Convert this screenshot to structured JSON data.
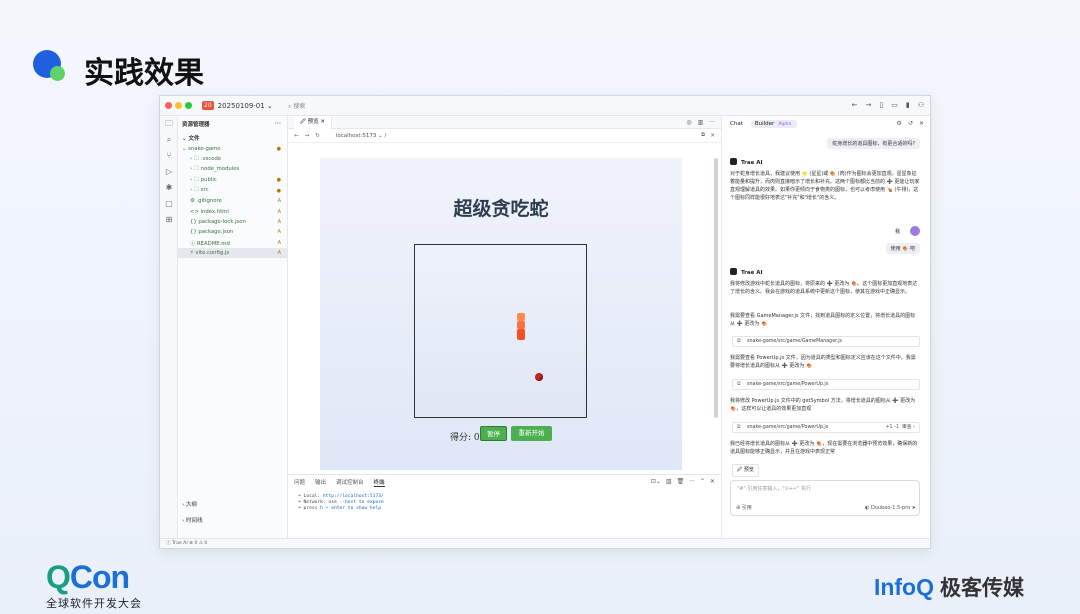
{
  "slide": {
    "title": "实践效果"
  },
  "titlebar": {
    "badge": "20",
    "project": "20250109-01 ⌄",
    "search": "⌕ 搜索"
  },
  "explorer": {
    "title": "资源管理器",
    "more": "···",
    "section": "⌄ 文件",
    "items": [
      {
        "label": "⌄ snake-game",
        "mark": "●"
      },
      {
        "label": "› 🗀 .vscode",
        "mark": ""
      },
      {
        "label": "› 🗀 node_modules",
        "mark": ""
      },
      {
        "label": "› 🗀 public",
        "mark": "●"
      },
      {
        "label": "› 🗀 src",
        "mark": "●"
      },
      {
        "label": "⚙ .gitignore",
        "mark": "A"
      },
      {
        "label": "<> index.html",
        "mark": "A"
      },
      {
        "label": "{} package-lock.json",
        "mark": "A"
      },
      {
        "label": "{} package.json",
        "mark": "A"
      },
      {
        "label": "ⓘ README.md",
        "mark": "A"
      },
      {
        "label": "⚡ vite.config.js",
        "mark": "A"
      }
    ],
    "outline": "› 大纲",
    "timeline": "› 时间线"
  },
  "editor": {
    "tab": "🖉 预览  ✕",
    "url": "localhost:5173   ⌄  /",
    "game_title": "超级贪吃蛇",
    "score_label": "得分: 0",
    "pause_btn": "暂停",
    "restart_btn": "重新开始"
  },
  "panel": {
    "tabs": [
      "问题",
      "输出",
      "调试控制台",
      "终端"
    ],
    "term_lines": [
      {
        "a": "➜  Local:   ",
        "b": "http://localhost:5173/"
      },
      {
        "a": "➜  Network: use ",
        "b": "--host to expose"
      },
      {
        "a": "➜  press ",
        "b": "h + enter to show help"
      }
    ]
  },
  "chat": {
    "tab_chat": "Chat",
    "tab_builder": "Builder",
    "alpha": "Alpha",
    "user_q1": "蛇身增长的道具图标，有更合适的吗?",
    "ai_name": "Trae AI",
    "ai_para1": "对于蛇身增长道具，我建议使用 ⭐ (星星)或 🍖 (肉)作为图标会更加直观。星星象征着能量和提升，而肉则直接暗示了增长和补充。这两个图标都比当前的 ➕ 更能让玩家直观理解道具的效果。如果你更倾向于食物类的图标，也可以考虑使用 🍗 (牛排)，这个图标同样能很好地表达\"补充\"和\"增长\"的含义。",
    "user_label": "我",
    "user_q2": "使用 🍖 吧",
    "ai_para2": "我将修改游戏中蛇长道具的图标，将原来的 ➕ 更改为 🍖。这个图标更加直观地表达了增长的含义。我会在游戏的道具系统中更新这个图标，使其在游戏中正确显示。",
    "ai_para3": "我需要查看 GameManager.js 文件，找到道具图标的定义位置，将增长道具的图标从 ➕ 更改为 🍖",
    "file1": "snake-game/src/game/GameManager.js",
    "ai_para4": "我需要查看 PowerUp.js 文件，因为道具的类型和图标定义应该在这个文件中。我需要将增长道具的图标从 ➕ 更改为 🍖",
    "file2": "snake-game/src/game/PowerUp.js",
    "ai_para5": "我将修改 PowerUp.js 文件中的 getSymbol 方法，将增长道具的图标从 ➕ 更改为 🍖，这样可以让道具的效果更加直观",
    "file3": "snake-game/src/game/PowerUp.js",
    "diff": "+1 -1",
    "review": "审查 ›",
    "ai_para6": "我已经将增长道具的图标从 ➕ 更改为 🍖，现在需要在浏览器中预览效果，确保新的道具图标能够正确显示，并且在游戏中表现正常",
    "preview_btn": "🖉 预览",
    "input_placeholder": "\"#\" 引用任意输入，\"⊙+↵\" 执行",
    "foot_left": "⊕ 引用",
    "foot_right": "◐ Doubao-1.5-pro  ➤"
  },
  "statusbar": {
    "text": "ⓘ Trae AI  ⊗ 0 ⚠ 0"
  },
  "footer": {
    "qcon_sub": "全球软件开发大会",
    "infoq": "InfoQ",
    "infoq_cn": "极客传媒"
  },
  "colors": {
    "accent": "#1f5fe0",
    "green_button": "#4caf50",
    "food": "#c62828"
  }
}
